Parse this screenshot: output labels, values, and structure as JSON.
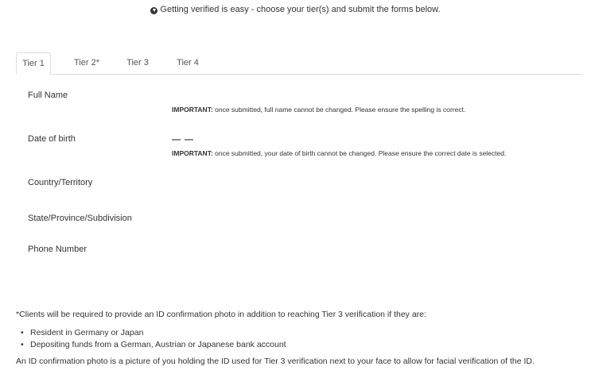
{
  "banner": {
    "icon": "circle-arrow-down-icon",
    "text": "Getting verified is easy - choose your tier(s) and submit the forms below."
  },
  "tabs": [
    {
      "label": "Tier 1",
      "active": true
    },
    {
      "label": "Tier 2*",
      "active": false
    },
    {
      "label": "Tier 3",
      "active": false
    },
    {
      "label": "Tier 4",
      "active": false
    }
  ],
  "form": {
    "full_name_label": "Full Name",
    "full_name_note_strong": "IMPORTANT:",
    "full_name_note": " once submitted, full name cannot be changed. Please ensure the spelling is correct.",
    "dob_label": "Date of birth",
    "dob_value": "— —",
    "dob_note_strong": "IMPORTANT:",
    "dob_note": " once submitted, your date of birth cannot be changed. Please ensure the correct date is selected.",
    "country_label": "Country/Territory",
    "state_label": "State/Province/Subdivision",
    "phone_label": "Phone Number"
  },
  "footer": {
    "clients_note": "*Clients will be required to provide an ID confirmation photo in addition to reaching Tier 3 verification if they are:",
    "bullets": [
      "Resident in Germany or Japan",
      "Depositing funds from a German, Austrian or Japanese bank account"
    ],
    "id_photo_note": "An ID confirmation photo is a picture of you holding the ID used for Tier 3 verification next to your face to allow for facial verification of the ID."
  }
}
